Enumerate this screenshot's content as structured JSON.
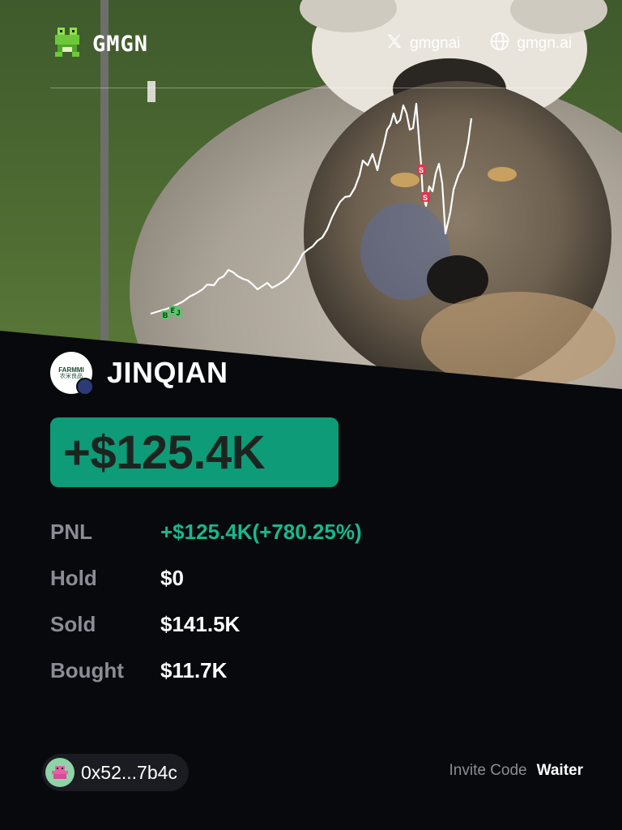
{
  "brand": {
    "name": "GMGN",
    "logo_icon": "frog-icon"
  },
  "header": {
    "twitter_icon": "x-icon",
    "twitter_handle": "gmgnai",
    "web_icon": "globe-icon",
    "website": "gmgn.ai"
  },
  "hero": {
    "price_chart": {
      "markers": [
        {
          "label": "B",
          "kind": "buy"
        },
        {
          "label": "B",
          "kind": "buy"
        },
        {
          "label": "J",
          "kind": "buy"
        },
        {
          "label": "S",
          "kind": "sell"
        },
        {
          "label": "S",
          "kind": "sell"
        }
      ]
    }
  },
  "token": {
    "name": "JINQIAN",
    "logo_text_line1": "FARMMI",
    "logo_text_line2": "农米良品"
  },
  "pnl_headline": "+$125.4K",
  "stats": [
    {
      "label": "PNL",
      "value": "+$125.4K(+780.25%)",
      "highlight": true
    },
    {
      "label": "Hold",
      "value": "$0",
      "highlight": false
    },
    {
      "label": "Sold",
      "value": "$141.5K",
      "highlight": false
    },
    {
      "label": "Bought",
      "value": "$11.7K",
      "highlight": false
    }
  ],
  "footer": {
    "wallet_address": "0x52...7b4c",
    "invite_label": "Invite Code",
    "invite_code": "Waiter"
  },
  "colors": {
    "accent_green": "#16b98e",
    "pill_green": "#0e9b78",
    "background": "#08090c",
    "buy_marker": "#5cc46a",
    "sell_marker": "#e0354f"
  }
}
